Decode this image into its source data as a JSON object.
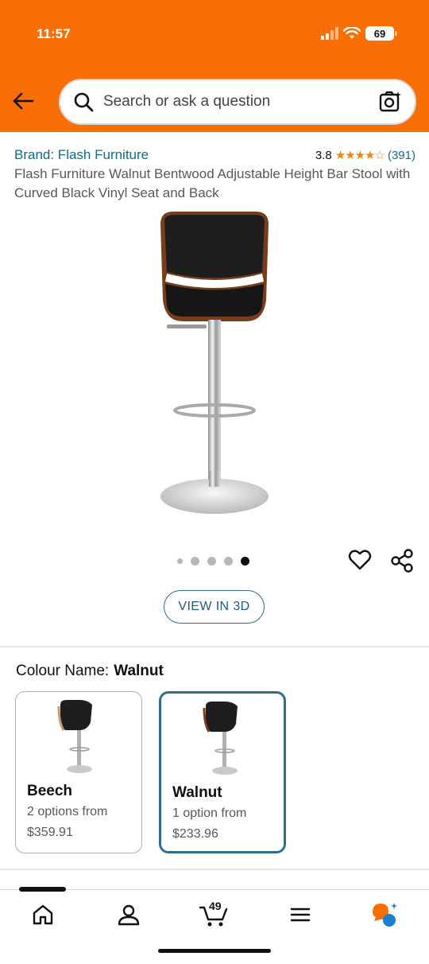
{
  "status_bar": {
    "time": "11:57",
    "battery": "69"
  },
  "search": {
    "placeholder": "Search or ask a question"
  },
  "product": {
    "brand": "Brand: Flash Furniture",
    "rating": "3.8",
    "stars": "★★★★☆",
    "rating_count": "(391)",
    "title": "Flash Furniture Walnut Bentwood Adjustable Height Bar Stool with Curved Black Vinyl Seat and Back",
    "image_count": 5,
    "active_image": 5
  },
  "view_3d_label": "VIEW IN 3D",
  "colour": {
    "label": "Colour Name:",
    "selected": "Walnut",
    "options": [
      {
        "name": "Beech",
        "options_text": "2 options from",
        "price": "$359.91"
      },
      {
        "name": "Walnut",
        "options_text": "1 option from",
        "price": "$233.96"
      }
    ]
  },
  "tab_bar": {
    "cart_count": "49"
  },
  "colors": {
    "header": "#f96f05",
    "link": "#0a6d8d",
    "star": "#f08804",
    "selected_border": "#2f6e8e"
  }
}
